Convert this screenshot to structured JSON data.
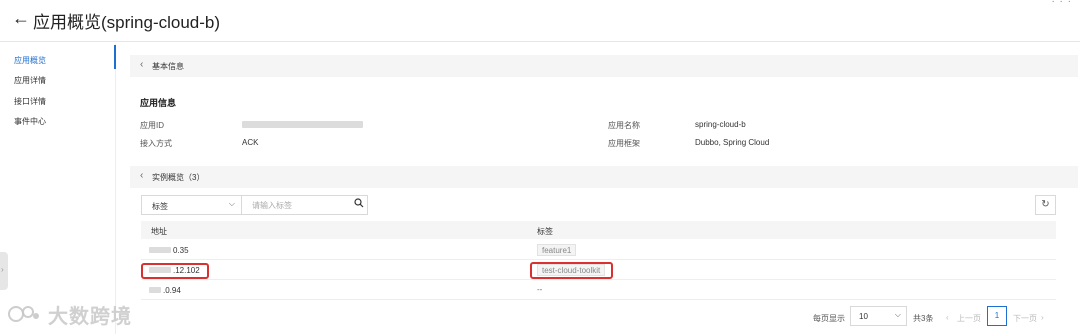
{
  "header": {
    "back_arrow": "←",
    "title": "应用概览(spring-cloud-b)"
  },
  "sidebar": {
    "items": [
      {
        "label": "应用概览",
        "active": true
      },
      {
        "label": "应用详情"
      },
      {
        "label": "接口详情"
      },
      {
        "label": "事件中心"
      }
    ]
  },
  "basic_info_section": {
    "title": "基本信息",
    "heading": "应用信息",
    "fields": {
      "app_id_label": "应用ID",
      "app_name_label": "应用名称",
      "app_name_value": "spring-cloud-b",
      "access_label": "接入方式",
      "access_value": "ACK",
      "framework_label": "应用框架",
      "framework_value": "Dubbo, Spring Cloud"
    }
  },
  "instances_section": {
    "title": "实例概览（3）",
    "filter": {
      "select_value": "标签",
      "placeholder": "请输入标签"
    },
    "columns": {
      "address": "地址",
      "tag": "标签"
    },
    "rows": [
      {
        "address": "0.35",
        "tag": "feature1"
      },
      {
        "address": ".12.102",
        "tag": "test-cloud-toolkit"
      },
      {
        "address": ".0.94",
        "tag": "--"
      }
    ]
  },
  "pagination": {
    "per_page_label": "每页显示",
    "per_page_value": "10",
    "total": "共3条",
    "prev": "上一页",
    "current_page": "1",
    "next": "下一页"
  },
  "watermark": {
    "text": "大数跨境"
  },
  "colors": {
    "accent": "#1f6fd1",
    "highlight_box": "#d93030",
    "section_bg": "#f5f5f5"
  }
}
